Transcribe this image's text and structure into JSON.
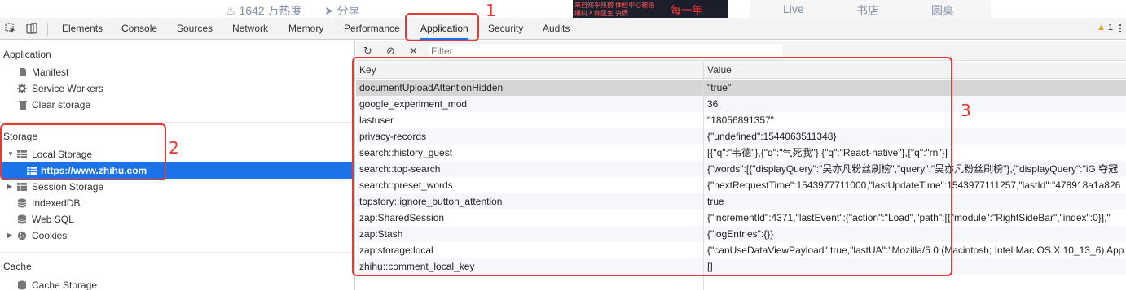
{
  "page_strip": {
    "hot": "1642 万热度",
    "share": "分享",
    "ad_line1": "来自知乎热榜 体检中心被指",
    "ad_line2": "爆料人称医生 资质",
    "ad_line3": "每一年",
    "live": "Live",
    "bookstore": "书店",
    "roundtable": "圆桌"
  },
  "toolbar": {
    "tabs": [
      "Elements",
      "Console",
      "Sources",
      "Network",
      "Memory",
      "Performance",
      "Application",
      "Security",
      "Audits"
    ],
    "active_tab": "Application",
    "warning_count": "1"
  },
  "sidebar": {
    "application_title": "Application",
    "application_items": [
      "Manifest",
      "Service Workers",
      "Clear storage"
    ],
    "storage_title": "Storage",
    "local_storage": "Local Storage",
    "local_storage_child": "https://www.zhihu.com",
    "session_storage": "Session Storage",
    "indexeddb": "IndexedDB",
    "websql": "Web SQL",
    "cookies": "Cookies",
    "cache_title": "Cache",
    "cache_storage": "Cache Storage"
  },
  "storage_panel": {
    "filter_placeholder": "Filter",
    "col_key": "Key",
    "col_value": "Value",
    "rows": [
      {
        "key": "documentUploadAttentionHidden",
        "value": "\"true\""
      },
      {
        "key": "google_experiment_mod",
        "value": "36"
      },
      {
        "key": "lastuser",
        "value": "\"18056891357\""
      },
      {
        "key": "privacy-records",
        "value": "{\"undefined\":1544063511348}"
      },
      {
        "key": "search::history_guest",
        "value": "[{\"q\":\"韦德\"},{\"q\":\"气死我\"},{\"q\":\"React-native\"},{\"q\":\"rn\"}]"
      },
      {
        "key": "search::top-search",
        "value": "{\"words\":[{\"displayQuery\":\"吴亦凡粉丝刷榜\",\"query\":\"吴亦凡粉丝刷榜\"},{\"displayQuery\":\"iG 夺冠"
      },
      {
        "key": "search::preset_words",
        "value": "{\"nextRequestTime\":1543977711000,\"lastUpdateTime\":1543977111257,\"lastId\":\"478918a1a826"
      },
      {
        "key": "topstory::ignore_button_attention",
        "value": "true"
      },
      {
        "key": "zap:SharedSession",
        "value": "{\"incrementId\":4371,\"lastEvent\":{\"action\":\"Load\",\"path\":[{\"module\":\"RightSideBar\",\"index\":0}],\""
      },
      {
        "key": "zap:Stash",
        "value": "{\"logEntries\":{}}"
      },
      {
        "key": "zap:storage:local",
        "value": "{\"canUseDataViewPayload\":true,\"lastUA\":\"Mozilla/5.0 (Macintosh; Intel Mac OS X 10_13_6) App"
      },
      {
        "key": "zhihu::comment_local_key",
        "value": "[]"
      }
    ],
    "selected_row": 0
  },
  "annotations": {
    "n1": "1",
    "n2": "2",
    "n3": "3",
    "color": "#e53935"
  },
  "colors": {
    "accent": "#1a73e8",
    "annotation": "#e53935"
  }
}
